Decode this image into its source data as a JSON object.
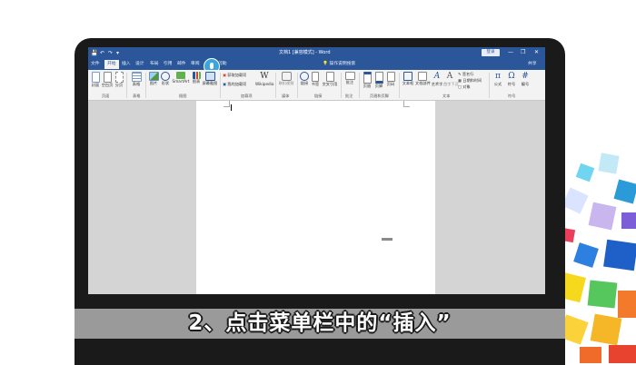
{
  "window": {
    "title": "文档1 [兼容模式] - Word",
    "login_label": "登录",
    "quick_access": [
      "💾",
      "↶",
      "↷",
      "▾"
    ],
    "controls": [
      "—",
      "❐",
      "✕"
    ]
  },
  "tabs": [
    {
      "label": "文件"
    },
    {
      "label": "开始"
    },
    {
      "label": "插入"
    },
    {
      "label": "设计"
    },
    {
      "label": "布局"
    },
    {
      "label": "引用"
    },
    {
      "label": "邮件"
    },
    {
      "label": "审阅"
    },
    {
      "label": "视图"
    },
    {
      "label": "帮助"
    }
  ],
  "tell_me": "操作说明搜索",
  "share_label": "共享",
  "ribbon": {
    "pages_group": {
      "label": "页面",
      "buttons": [
        {
          "label": "封面"
        },
        {
          "label": "空白页"
        },
        {
          "label": "分页"
        }
      ]
    },
    "tables_group": {
      "label": "表格",
      "buttons": [
        {
          "label": "表格"
        }
      ]
    },
    "illustrations_group": {
      "label": "插图",
      "buttons": [
        {
          "label": "图片"
        },
        {
          "label": "形状"
        },
        {
          "label": "SmartArt"
        },
        {
          "label": "图表"
        },
        {
          "label": "屏幕截图"
        }
      ]
    },
    "addins_group": {
      "label": "加载项",
      "items": [
        {
          "label": "获取加载项"
        },
        {
          "label": "我的加载项"
        }
      ],
      "wikipedia_label": "Wikipedia"
    },
    "media_group": {
      "label": "媒体",
      "buttons": [
        {
          "label": "联机视频"
        }
      ]
    },
    "links_group": {
      "label": "链接",
      "buttons": [
        {
          "label": "链接"
        },
        {
          "label": "书签"
        },
        {
          "label": "交叉引用"
        }
      ]
    },
    "comments_group": {
      "label": "批注",
      "buttons": [
        {
          "label": "批注"
        }
      ]
    },
    "header_group": {
      "label": "页眉和页脚",
      "buttons": [
        {
          "label": "页眉"
        },
        {
          "label": "页脚"
        },
        {
          "label": "页码"
        }
      ]
    },
    "text_group": {
      "label": "文本",
      "buttons": [
        {
          "label": "文本框"
        },
        {
          "label": "文档部件"
        },
        {
          "label": "艺术字"
        },
        {
          "label": "首字下沉"
        }
      ],
      "side_items": [
        {
          "label": "签名行"
        },
        {
          "label": "日期和时间"
        },
        {
          "label": "对象"
        }
      ]
    },
    "symbols_group": {
      "label": "符号",
      "buttons": [
        {
          "label": "公式",
          "glyph": "π"
        },
        {
          "label": "符号",
          "glyph": "Ω"
        },
        {
          "label": "编号",
          "glyph": "#"
        }
      ]
    }
  },
  "caption": "2、点击菜单栏中的“插入”",
  "colors": {
    "accent": "#2b579a",
    "ribbon": "#f3f3f3",
    "document_bg": "#d4d4d4"
  }
}
